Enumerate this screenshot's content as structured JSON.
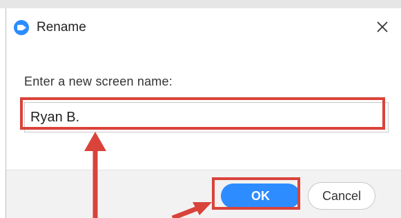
{
  "dialog": {
    "title": "Rename",
    "app_icon": "zoom-camera-icon",
    "close_icon": "close-icon",
    "prompt_label": "Enter a new screen name:",
    "name_value": "Ryan B.",
    "ok_label": "OK",
    "cancel_label": "Cancel"
  },
  "annotations": {
    "color": "#d9433a",
    "highlights": [
      "name-input",
      "ok-button"
    ],
    "arrows": [
      "arrow-to-name-input",
      "arrow-to-ok-button"
    ]
  },
  "colors": {
    "accent": "#2d8cff",
    "annotation": "#d9433a",
    "footer_bg": "#f2f2f2"
  }
}
